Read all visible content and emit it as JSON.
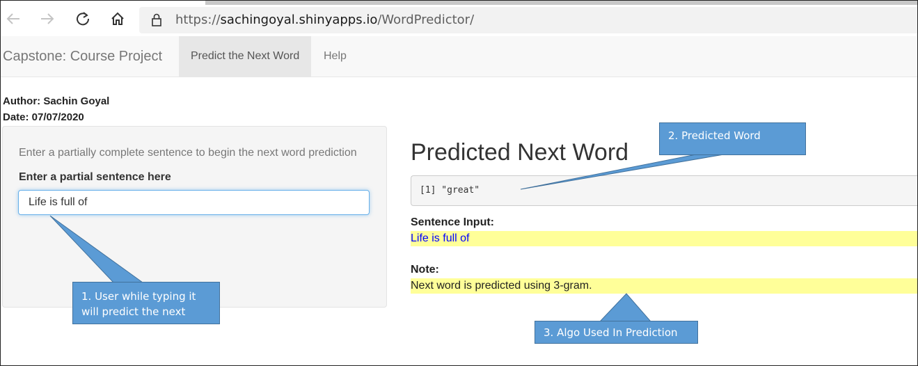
{
  "browser": {
    "url_prefix": "https://",
    "url_host": "sachingoyal.shinyapps.io",
    "url_path": "/WordPredictor/"
  },
  "navbar": {
    "brand": "Capstone: Course Project",
    "tabs": [
      {
        "label": "Predict the Next Word",
        "active": true
      },
      {
        "label": "Help",
        "active": false
      }
    ]
  },
  "header": {
    "author": "Author: Sachin Goyal",
    "date": "Date: 07/07/2020"
  },
  "sidebar": {
    "help_text": "Enter a partially complete sentence to begin the next word prediction",
    "input_label": "Enter a partial sentence here",
    "input_value": "Life is full of"
  },
  "main": {
    "title": "Predicted Next Word",
    "prediction_output": "[1] \"great\"",
    "sentence_label": "Sentence Input:",
    "sentence_value": "Life is full of",
    "note_label": "Note:",
    "note_value": "Next word is predicted using 3-gram."
  },
  "callouts": {
    "predicted_word": "2. Predicted Word",
    "user_typing_line1": "1. User while typing it",
    "user_typing_line2": "will predict the next",
    "algo_used": "3. Algo Used In Prediction"
  },
  "colors": {
    "callout_fill": "#5b9bd5",
    "highlight": "#ffff99",
    "input_text_blue": "#0000ff"
  }
}
